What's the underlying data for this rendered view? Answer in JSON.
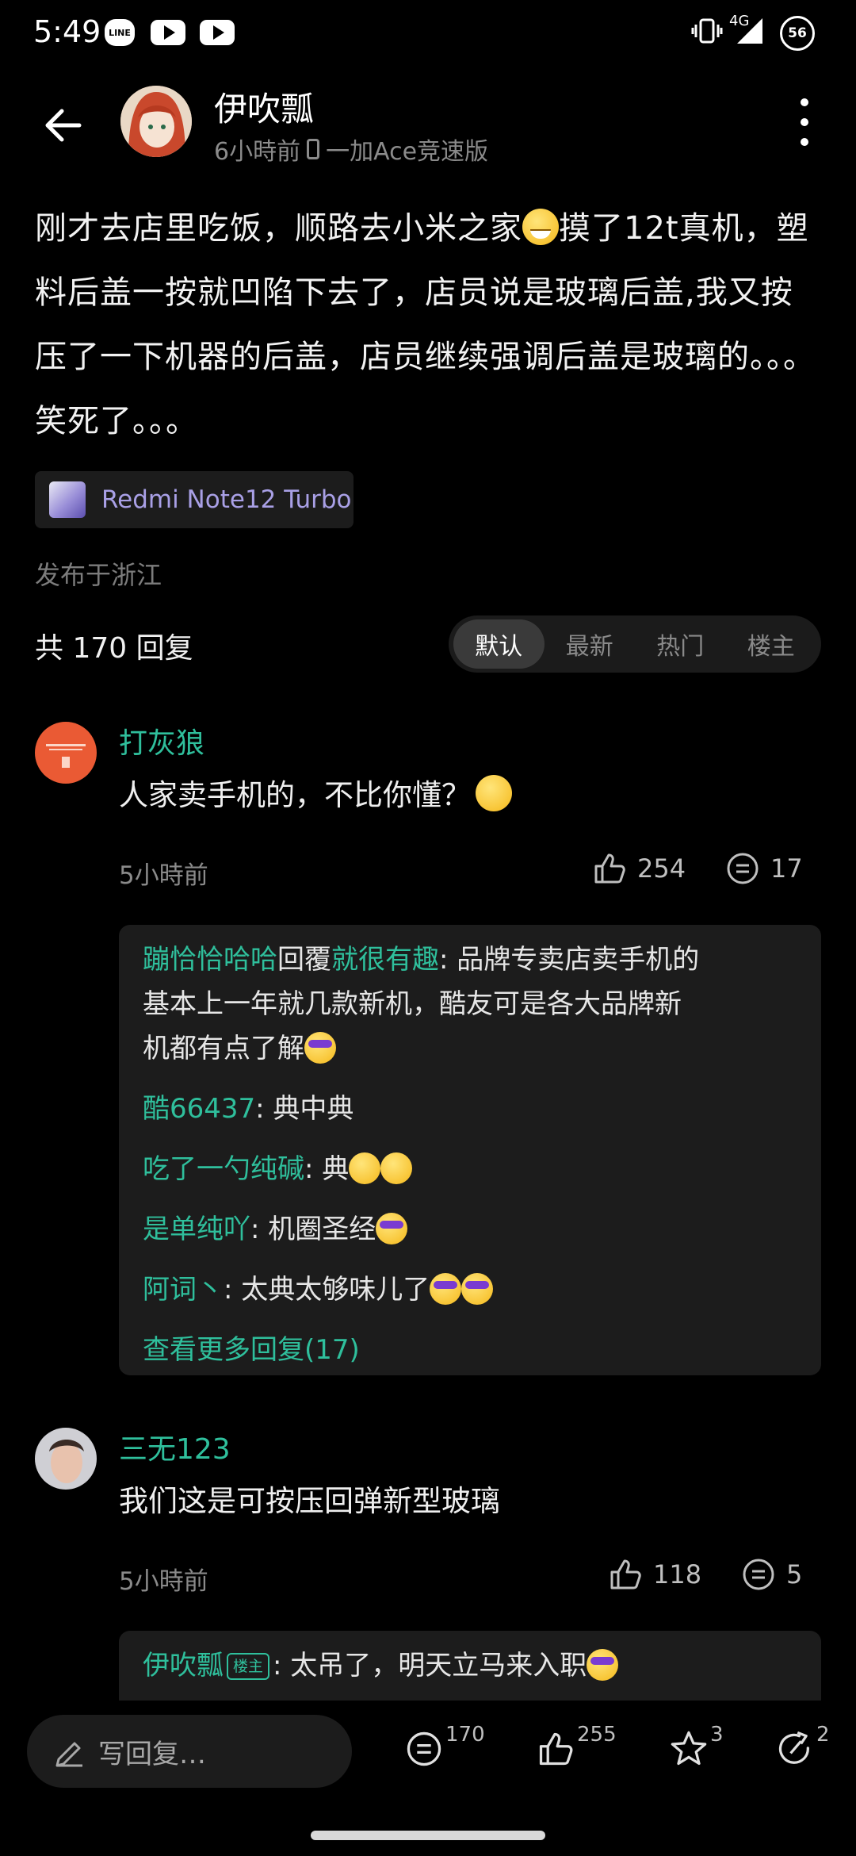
{
  "status_bar": {
    "time": "5:49",
    "line_badge": "LINE",
    "network": "4G",
    "battery": "56",
    "icons": [
      "line-icon",
      "youtube-icon",
      "youtube-icon",
      "vibrate-icon",
      "signal-icon",
      "battery-icon"
    ]
  },
  "header": {
    "author": "伊吹瓢",
    "time": "6小時前",
    "device": "一加Ace竞速版"
  },
  "post": {
    "text_1": "刚才去店里吃饭，顺路去小米之家",
    "text_2": "摸了12t真机，塑料后盖一按就凹陷下去了，店员说是玻璃后盖,我又按压了一下机器的后盖，店员继续强调后盖是玻璃的。。。笑死了。。。",
    "device_tag": "Redmi Note12 Turbo",
    "location": "发布于浙江"
  },
  "replies_header": {
    "count_label": "共 170 回复",
    "tabs": [
      "默认",
      "最新",
      "热门",
      "楼主"
    ],
    "active_tab": "默认"
  },
  "comments": [
    {
      "name": "打灰狼",
      "text": "人家卖手机的，不比你懂？",
      "time": "5小時前",
      "likes": "254",
      "replies": "17",
      "sub_replies": [
        {
          "user": "蹦恰恰哈哈",
          "mid": "回覆",
          "target": "就很有趣",
          "text_1": ": 品牌专卖店卖手机的",
          "text_2": "基本上一年就几款新机，酷友可是各大品牌新",
          "text_3": "机都有点了解"
        },
        {
          "user": "酷66437",
          "text": ": 典中典"
        },
        {
          "user": "吃了一勺纯碱",
          "text": ": 典"
        },
        {
          "user": "是单纯吖",
          "text": ": 机圈圣经"
        },
        {
          "user": "阿词丶",
          "text": ": 太典太够味儿了"
        }
      ],
      "more_replies": "查看更多回复(17)"
    },
    {
      "name": "三无123",
      "text": "我们这是可按压回弹新型玻璃",
      "time": "5小時前",
      "likes": "118",
      "replies": "5",
      "sub_replies": [
        {
          "user": "伊吹瓢",
          "badge": "楼主",
          "text": ": 太吊了，明天立马来入职"
        }
      ]
    }
  ],
  "bottom_bar": {
    "reply_placeholder": "写回复…",
    "comments": "170",
    "likes": "255",
    "favorites": "3",
    "shares": "2"
  }
}
